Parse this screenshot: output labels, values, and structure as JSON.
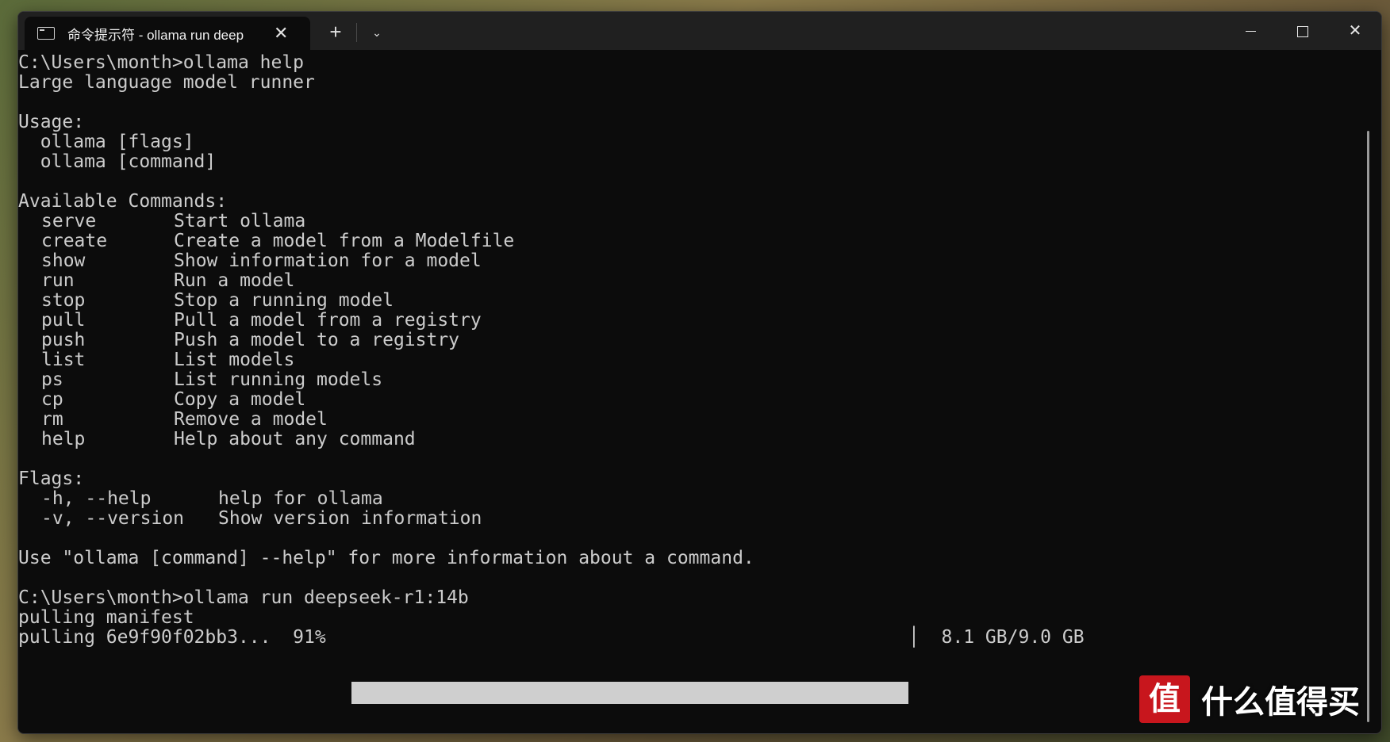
{
  "window": {
    "tab_title": "命令提示符 - ollama  run deep",
    "new_tab_label": "+",
    "dropdown_label": "⌄",
    "close_tab_label": "✕",
    "close_window_label": "✕"
  },
  "terminal": {
    "prompt1": "C:\\Users\\month>ollama help",
    "description": "Large language model runner",
    "usage_header": "Usage:",
    "usage_lines": [
      "  ollama [flags]",
      "  ollama [command]"
    ],
    "commands_header": "Available Commands:",
    "commands": [
      {
        "name": "serve",
        "desc": "Start ollama"
      },
      {
        "name": "create",
        "desc": "Create a model from a Modelfile"
      },
      {
        "name": "show",
        "desc": "Show information for a model"
      },
      {
        "name": "run",
        "desc": "Run a model"
      },
      {
        "name": "stop",
        "desc": "Stop a running model"
      },
      {
        "name": "pull",
        "desc": "Pull a model from a registry"
      },
      {
        "name": "push",
        "desc": "Push a model to a registry"
      },
      {
        "name": "list",
        "desc": "List models"
      },
      {
        "name": "ps",
        "desc": "List running models"
      },
      {
        "name": "cp",
        "desc": "Copy a model"
      },
      {
        "name": "rm",
        "desc": "Remove a model"
      },
      {
        "name": "help",
        "desc": "Help about any command"
      }
    ],
    "flags_header": "Flags:",
    "flags": [
      {
        "name": "-h, --help",
        "desc": "help for ollama"
      },
      {
        "name": "-v, --version",
        "desc": "Show version information"
      }
    ],
    "footer_hint": "Use \"ollama [command] --help\" for more information about a command.",
    "prompt2": "C:\\Users\\month>ollama run deepseek-r1:14b",
    "pulling_manifest": "pulling manifest",
    "pull_line": "pulling 6e9f90f02bb3...  91%",
    "progress_percent": 91,
    "progress_size": "│  8.1 GB/9.0 GB"
  },
  "watermark": {
    "mark": "值",
    "text": "什么值得买"
  },
  "colors": {
    "terminal_bg": "#0c0c0c",
    "terminal_text": "#cccccc",
    "titlebar_bg": "#202020",
    "progress_fill": "#cfcfcf",
    "watermark_red": "#c8161d"
  }
}
